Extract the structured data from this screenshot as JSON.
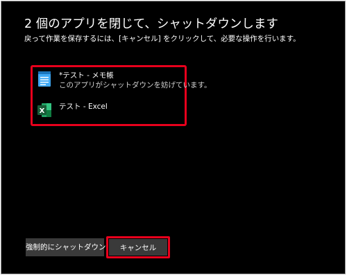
{
  "dialog": {
    "title": "2 個のアプリを閉じて、シャットダウンします",
    "subtitle": "戻って作業を保存するには、[キャンセル] をクリックして、必要な操作を行います。"
  },
  "apps": [
    {
      "name": "*テスト - メモ帳",
      "status": "このアプリがシャットダウンを妨げています。",
      "icon": "notepad-icon"
    },
    {
      "name": "テスト - Excel",
      "icon": "excel-icon"
    }
  ],
  "buttons": {
    "force_shutdown": "強制的にシャットダウン",
    "cancel": "キャンセル"
  },
  "colors": {
    "background": "#000000",
    "highlight": "#e8001c",
    "button": "#3a3a3a",
    "excel_green": "#1e7145",
    "notepad_blue": "#3fa9f5"
  }
}
